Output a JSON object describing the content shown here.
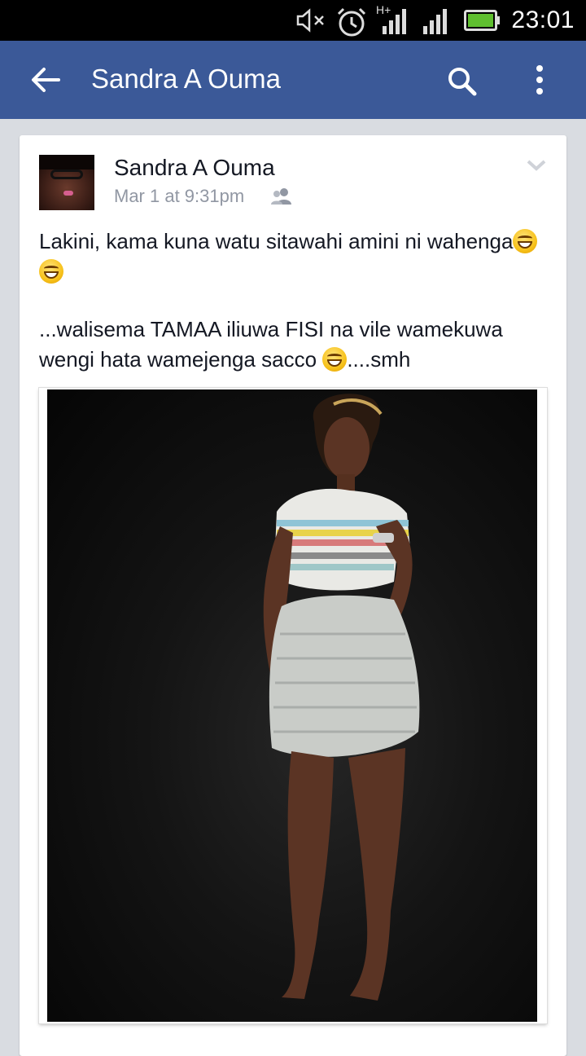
{
  "status_bar": {
    "time": "23:01",
    "network_label": "H+",
    "icons": [
      "mute-icon",
      "alarm-icon",
      "signal-icon",
      "signal-icon",
      "battery-icon"
    ]
  },
  "app_bar": {
    "title": "Sandra A Ouma",
    "back_icon": "arrow-left-icon",
    "search_icon": "search-icon",
    "more_icon": "more-vertical-icon",
    "color": "#3b5998"
  },
  "post": {
    "author": "Sandra A Ouma",
    "timestamp": "Mar 1 at 9:31pm",
    "audience_icon": "friends-icon",
    "text_line1": "Lakini, kama kuna watu sitawahi amini ni wahenga",
    "text_line2_a": "...walisema TAMAA iliuwa FISI na vile wamekuwa wengi hata wamejenga sacco ",
    "text_line2_b": "....smh",
    "emoji": "grinning-face-with-smiling-eyes"
  }
}
